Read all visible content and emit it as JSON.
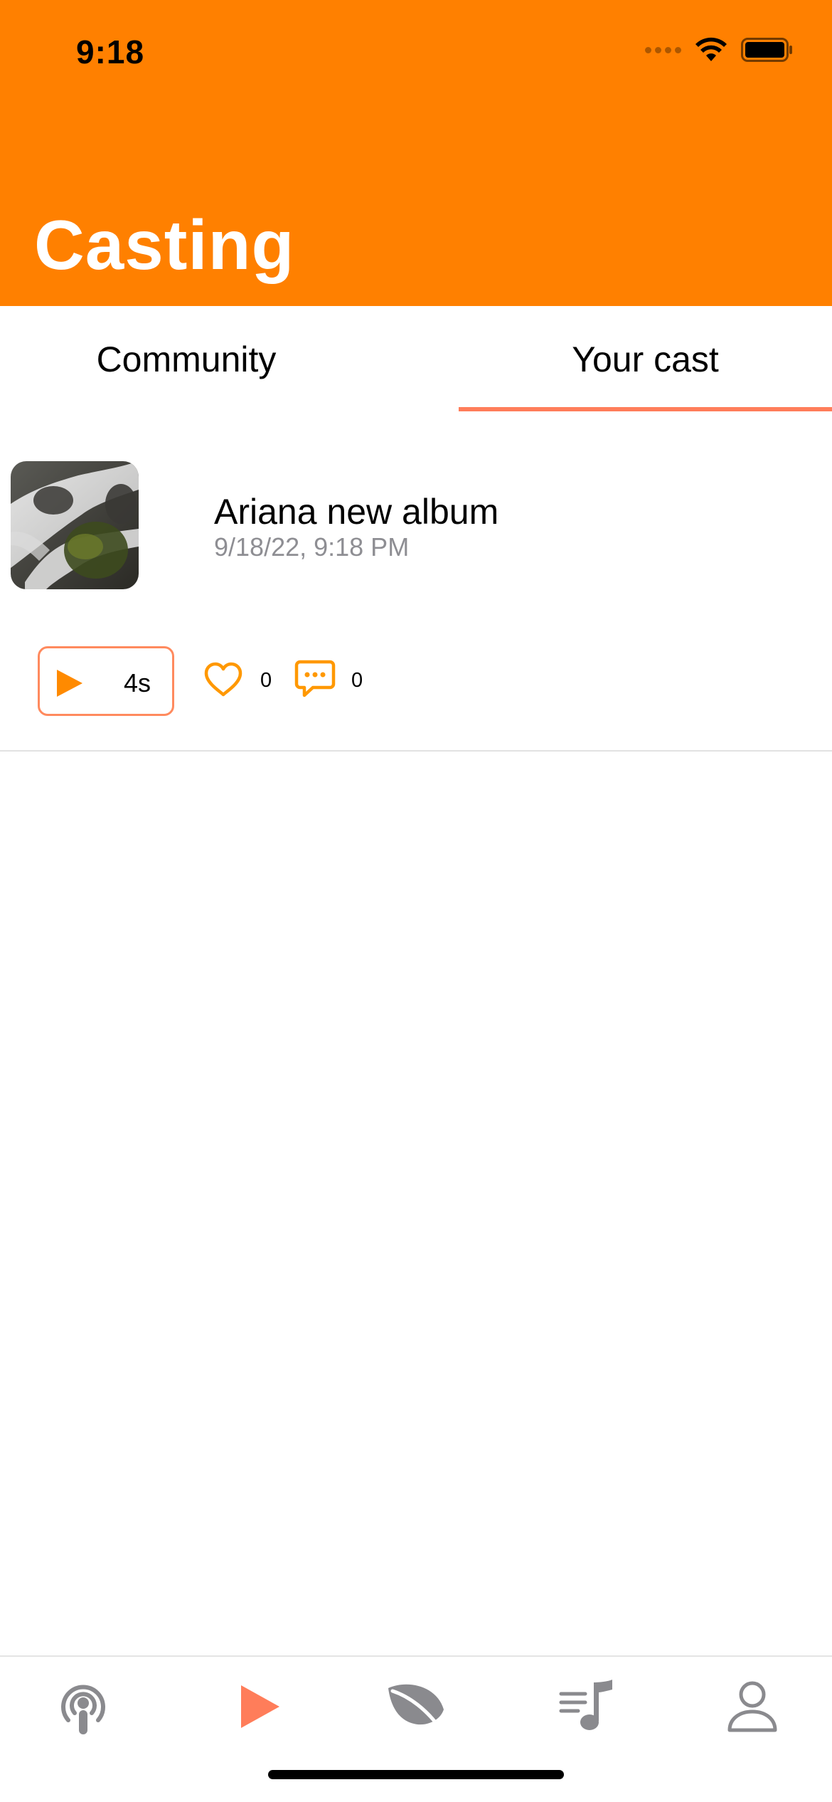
{
  "status_bar": {
    "time": "9:18"
  },
  "header": {
    "title": "Casting"
  },
  "tabs": [
    {
      "label": "Community",
      "selected": false
    },
    {
      "label": "Your cast",
      "selected": true
    }
  ],
  "cast": {
    "title": "Ariana new album",
    "date": "9/18/22, 9:18 PM",
    "duration": "4s",
    "likes": "0",
    "comments": "0"
  },
  "tab_bar": {
    "items": [
      {
        "icon": "podcast-icon",
        "active": false
      },
      {
        "icon": "play-icon",
        "active": true
      },
      {
        "icon": "leaf-icon",
        "active": false
      },
      {
        "icon": "playlist-icon",
        "active": false
      },
      {
        "icon": "person-icon",
        "active": false
      }
    ]
  },
  "colors": {
    "header_bg": "#FF8000",
    "accent": "#FF8000",
    "tab_indicator": "#FF7D5A",
    "play_button_border": "#FF8A5E",
    "inactive_icon": "#8A8A8E",
    "active_tab_icon": "#FF7D5A"
  }
}
